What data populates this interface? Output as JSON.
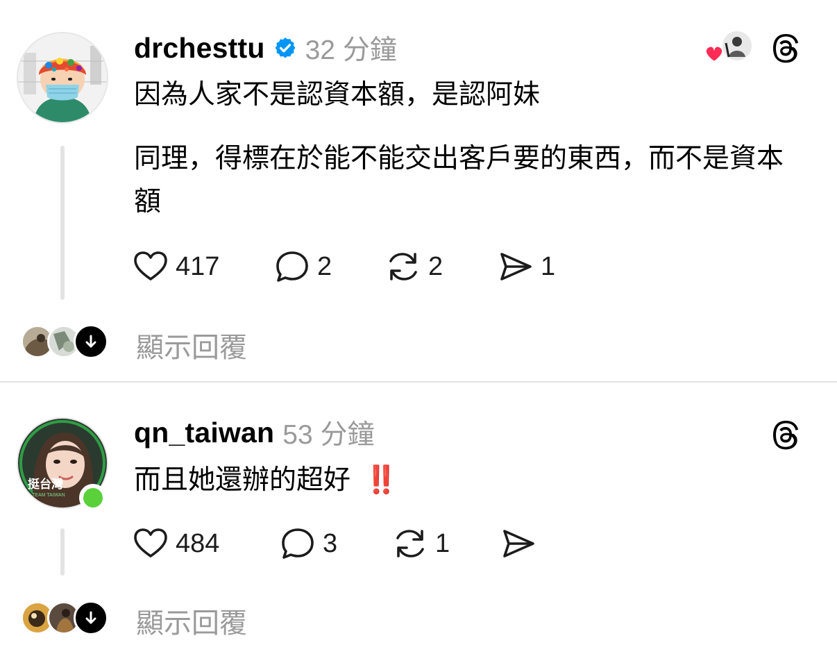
{
  "posts": [
    {
      "username": "drchesttu",
      "verified": true,
      "time": "32 分鐘",
      "paragraphs": [
        "因為人家不是認資本額，是認阿妹",
        "同理，得標在於能不能交出客戶要的東西，而不是資本額"
      ],
      "likes": "417",
      "comments": "2",
      "reposts": "2",
      "shares": "1",
      "show_replies": "顯示回覆",
      "liked_by_icon": "heart-icon",
      "avatar_icon": "cartoon-surgeon-avatar"
    },
    {
      "username": "qn_taiwan",
      "verified": false,
      "time": "53 分鐘",
      "paragraphs": [
        "而且她還辦的超好",
        "‼️"
      ],
      "likes": "484",
      "comments": "3",
      "reposts": "1",
      "shares": "",
      "show_replies": "顯示回覆",
      "avatar_badge_text": "挺台灣",
      "avatar_badge_subtext": "TEAM TAIWAN",
      "online": true
    }
  ],
  "colors": {
    "verified_blue": "#0095f6",
    "online_green": "#5ad13a",
    "heart_red": "#ff2d55",
    "muted_text": "#9a9a9a",
    "divider": "#e3e3e3",
    "double_exclamation_red": "#e0201c"
  }
}
